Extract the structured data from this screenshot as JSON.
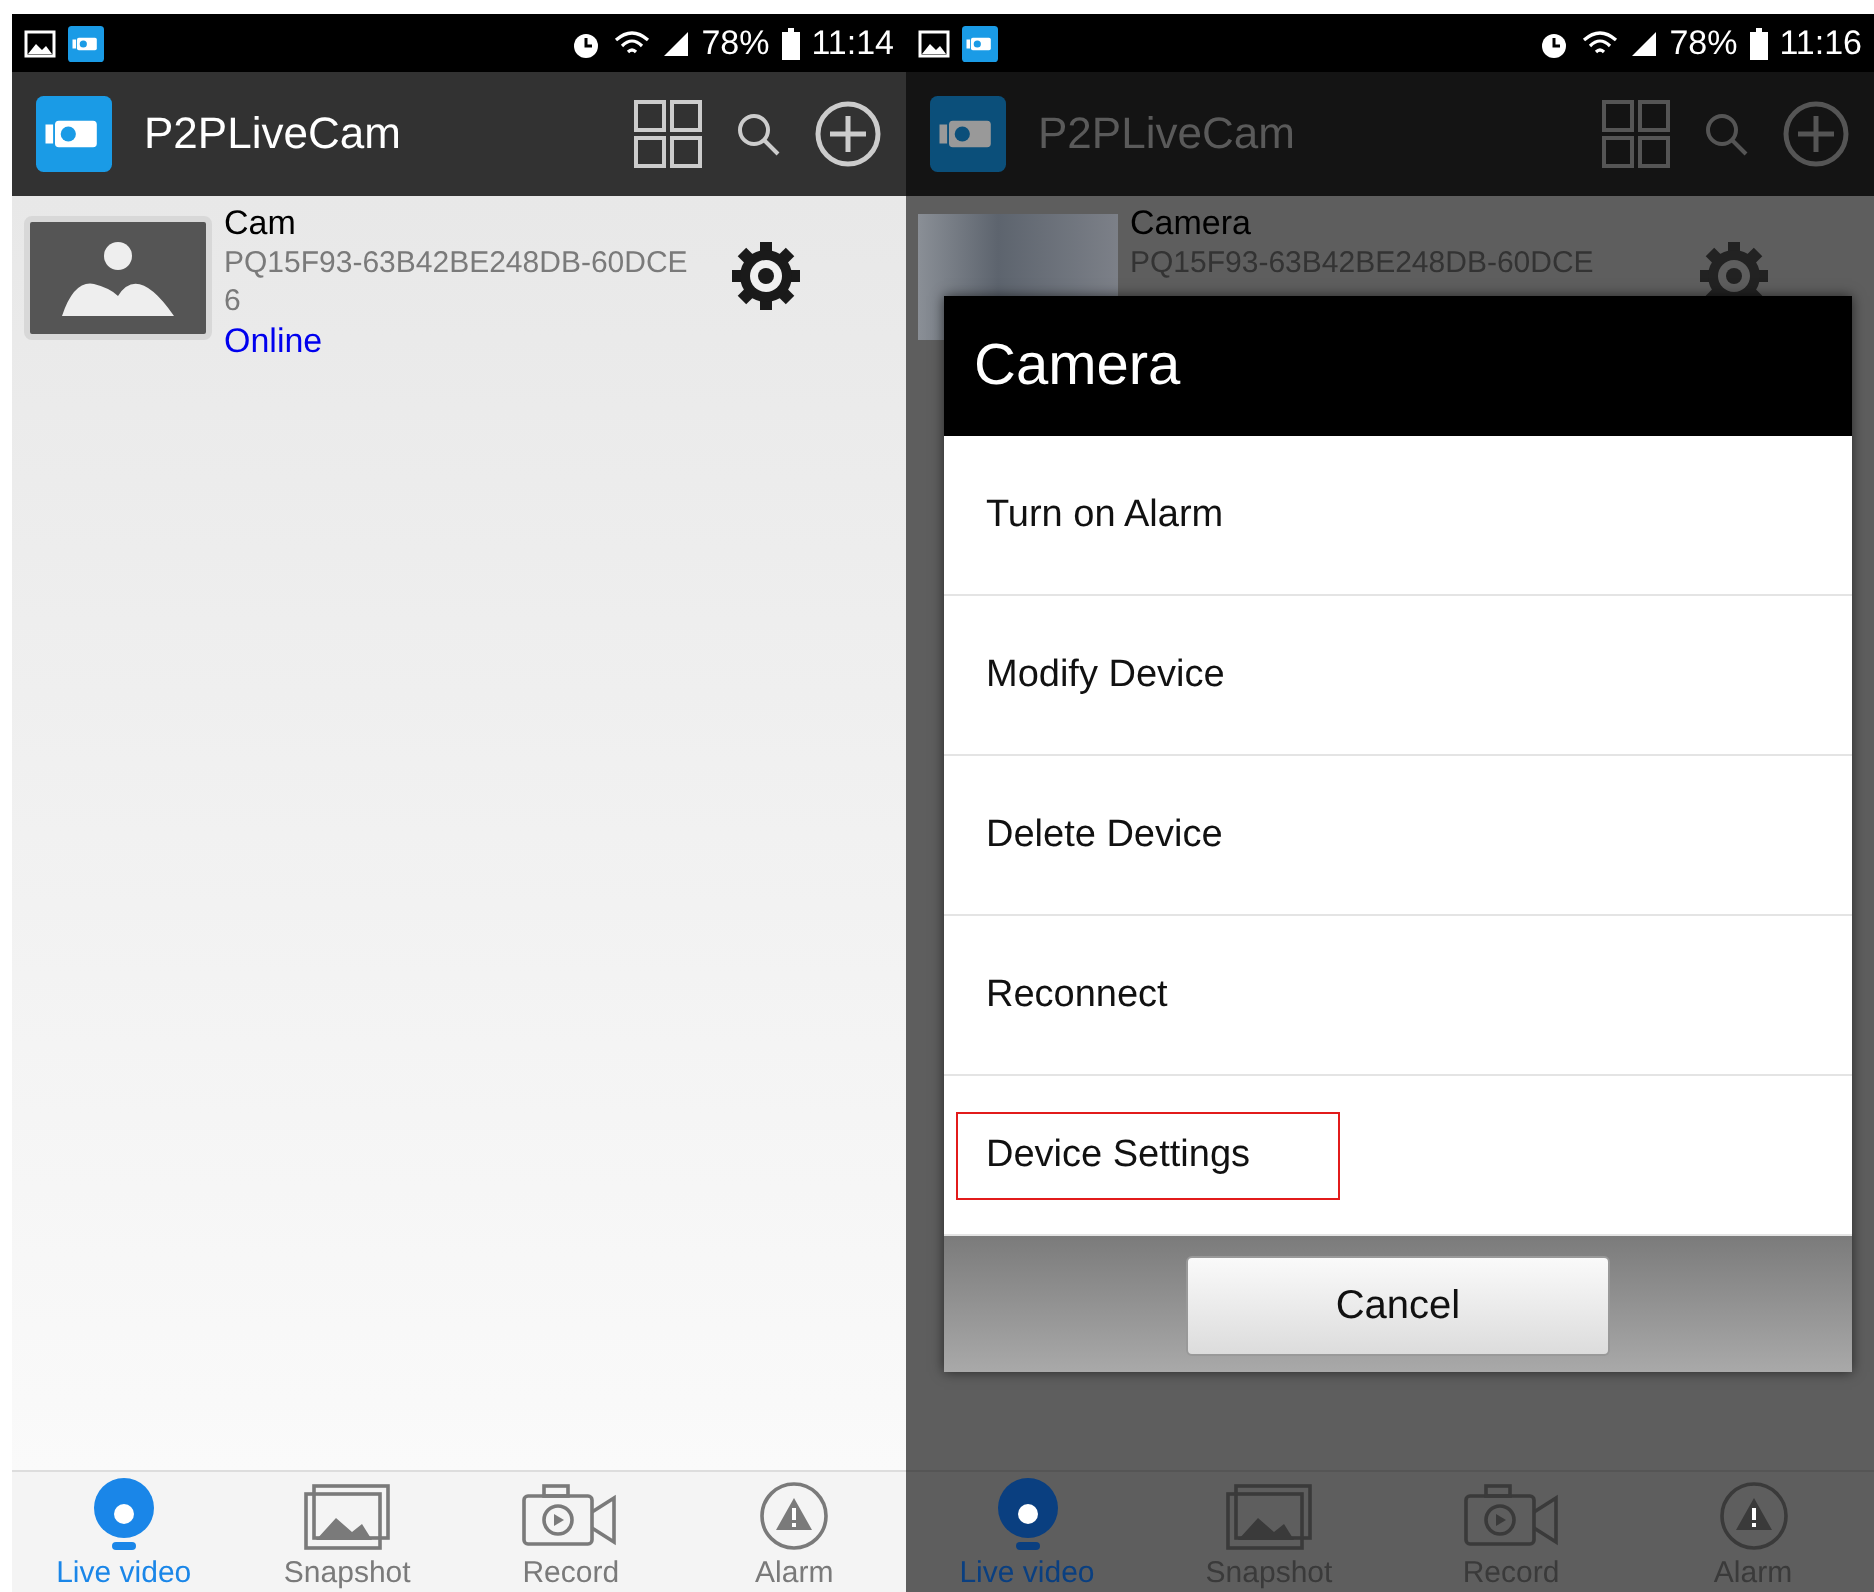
{
  "screens": [
    {
      "dimmed": false,
      "status_bar": {
        "battery": "78%",
        "time": "11:14"
      },
      "app_bar": {
        "title": "P2PLiveCam"
      },
      "devices": [
        {
          "kind": "placeholder",
          "name": "Cam",
          "id_lines": [
            "PQ15F93-63B42BE248DB-60DCE",
            "6"
          ],
          "status": "Online"
        }
      ],
      "nav_tabs": [
        {
          "label": "Live video",
          "selected": true
        },
        {
          "label": "Snapshot",
          "selected": false
        },
        {
          "label": "Record",
          "selected": false
        },
        {
          "label": "Alarm",
          "selected": false
        }
      ]
    },
    {
      "dimmed": true,
      "status_bar": {
        "battery": "78%",
        "time": "11:16"
      },
      "app_bar": {
        "title": "P2PLiveCam"
      },
      "devices": [
        {
          "kind": "photo",
          "name": "Camera",
          "id_lines": [
            "PQ15F93-63B42BE248DB-60DCE"
          ]
        }
      ],
      "dialog": {
        "title": "Camera",
        "items": [
          {
            "label": "Turn on Alarm",
            "highlighted": false
          },
          {
            "label": "Modify Device",
            "highlighted": false
          },
          {
            "label": "Delete Device",
            "highlighted": false
          },
          {
            "label": "Reconnect",
            "highlighted": false
          },
          {
            "label": "Device Settings",
            "highlighted": true
          }
        ],
        "cancel": "Cancel"
      },
      "nav_tabs": [
        {
          "label": "Live video",
          "selected": true
        },
        {
          "label": "Snapshot",
          "selected": false
        },
        {
          "label": "Record",
          "selected": false
        },
        {
          "label": "Alarm",
          "selected": false
        }
      ]
    }
  ]
}
